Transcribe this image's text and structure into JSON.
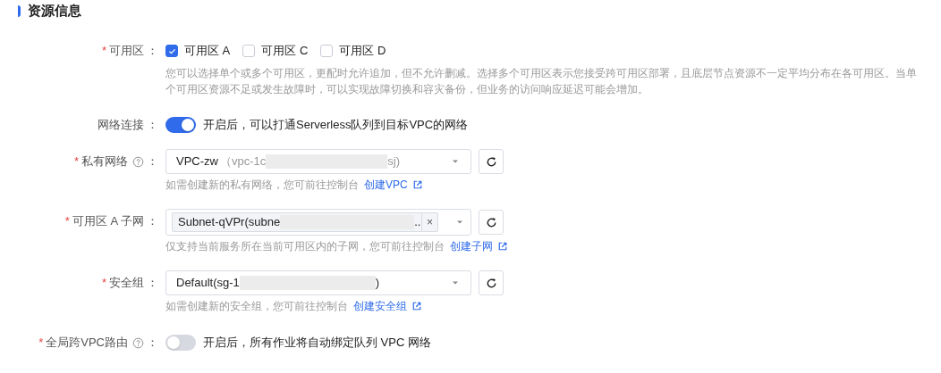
{
  "section_title": "资源信息",
  "fields": [
    {
      "kind": "checkboxes",
      "label": "可用区",
      "required_mark": "*",
      "help_icon": false,
      "colon": "：",
      "options": [
        {
          "label": "可用区 A",
          "checked": true
        },
        {
          "label": "可用区 C",
          "checked": false
        },
        {
          "label": "可用区 D",
          "checked": false
        }
      ],
      "help": "您可以选择单个或多个可用区，更配时允许追加，但不允许删减。选择多个可用区表示您接受跨可用区部署，且底层节点资源不一定平均分布在各可用区。当单个可用区资源不足或发生故障时，可以实现故障切换和容灾备份，但业务的访问响应延迟可能会增加。"
    },
    {
      "kind": "switch",
      "label": "网络连接",
      "help_icon": false,
      "colon": "：",
      "on": true,
      "text": "开启后，可以打通Serverless队列到目标VPC的网络"
    },
    {
      "kind": "select",
      "label": "私有网络",
      "required_mark": "*",
      "help_icon": true,
      "colon": "：",
      "value": "VPC-zw",
      "detail_start": "（vpc-1c",
      "detail_end": "sj)",
      "help": "如需创建新的私有网络，您可前往控制台",
      "link": "创建VPC"
    },
    {
      "kind": "tag-select",
      "label": "可用区 A 子网",
      "required_mark": "*",
      "help_icon": false,
      "colon": "：",
      "tag_start": "Subnet-qVPr(subne",
      "tag_end": "..",
      "clear": "×",
      "help": "仅支持当前服务所在当前可用区内的子网，您可前往控制台",
      "link": "创建子网"
    },
    {
      "kind": "select",
      "label": "安全组",
      "required_mark": "*",
      "help_icon": false,
      "colon": "：",
      "value": "Default(sg-1",
      "detail_end": ")",
      "help": "如需创建新的安全组，您可前往控制台",
      "link": "创建安全组"
    },
    {
      "kind": "switch",
      "label": "全局跨VPC路由",
      "required_mark": "*",
      "help_icon": true,
      "colon": "：",
      "on": false,
      "text": "开启后，所有作业将自动绑定队列 VPC 网络"
    }
  ]
}
